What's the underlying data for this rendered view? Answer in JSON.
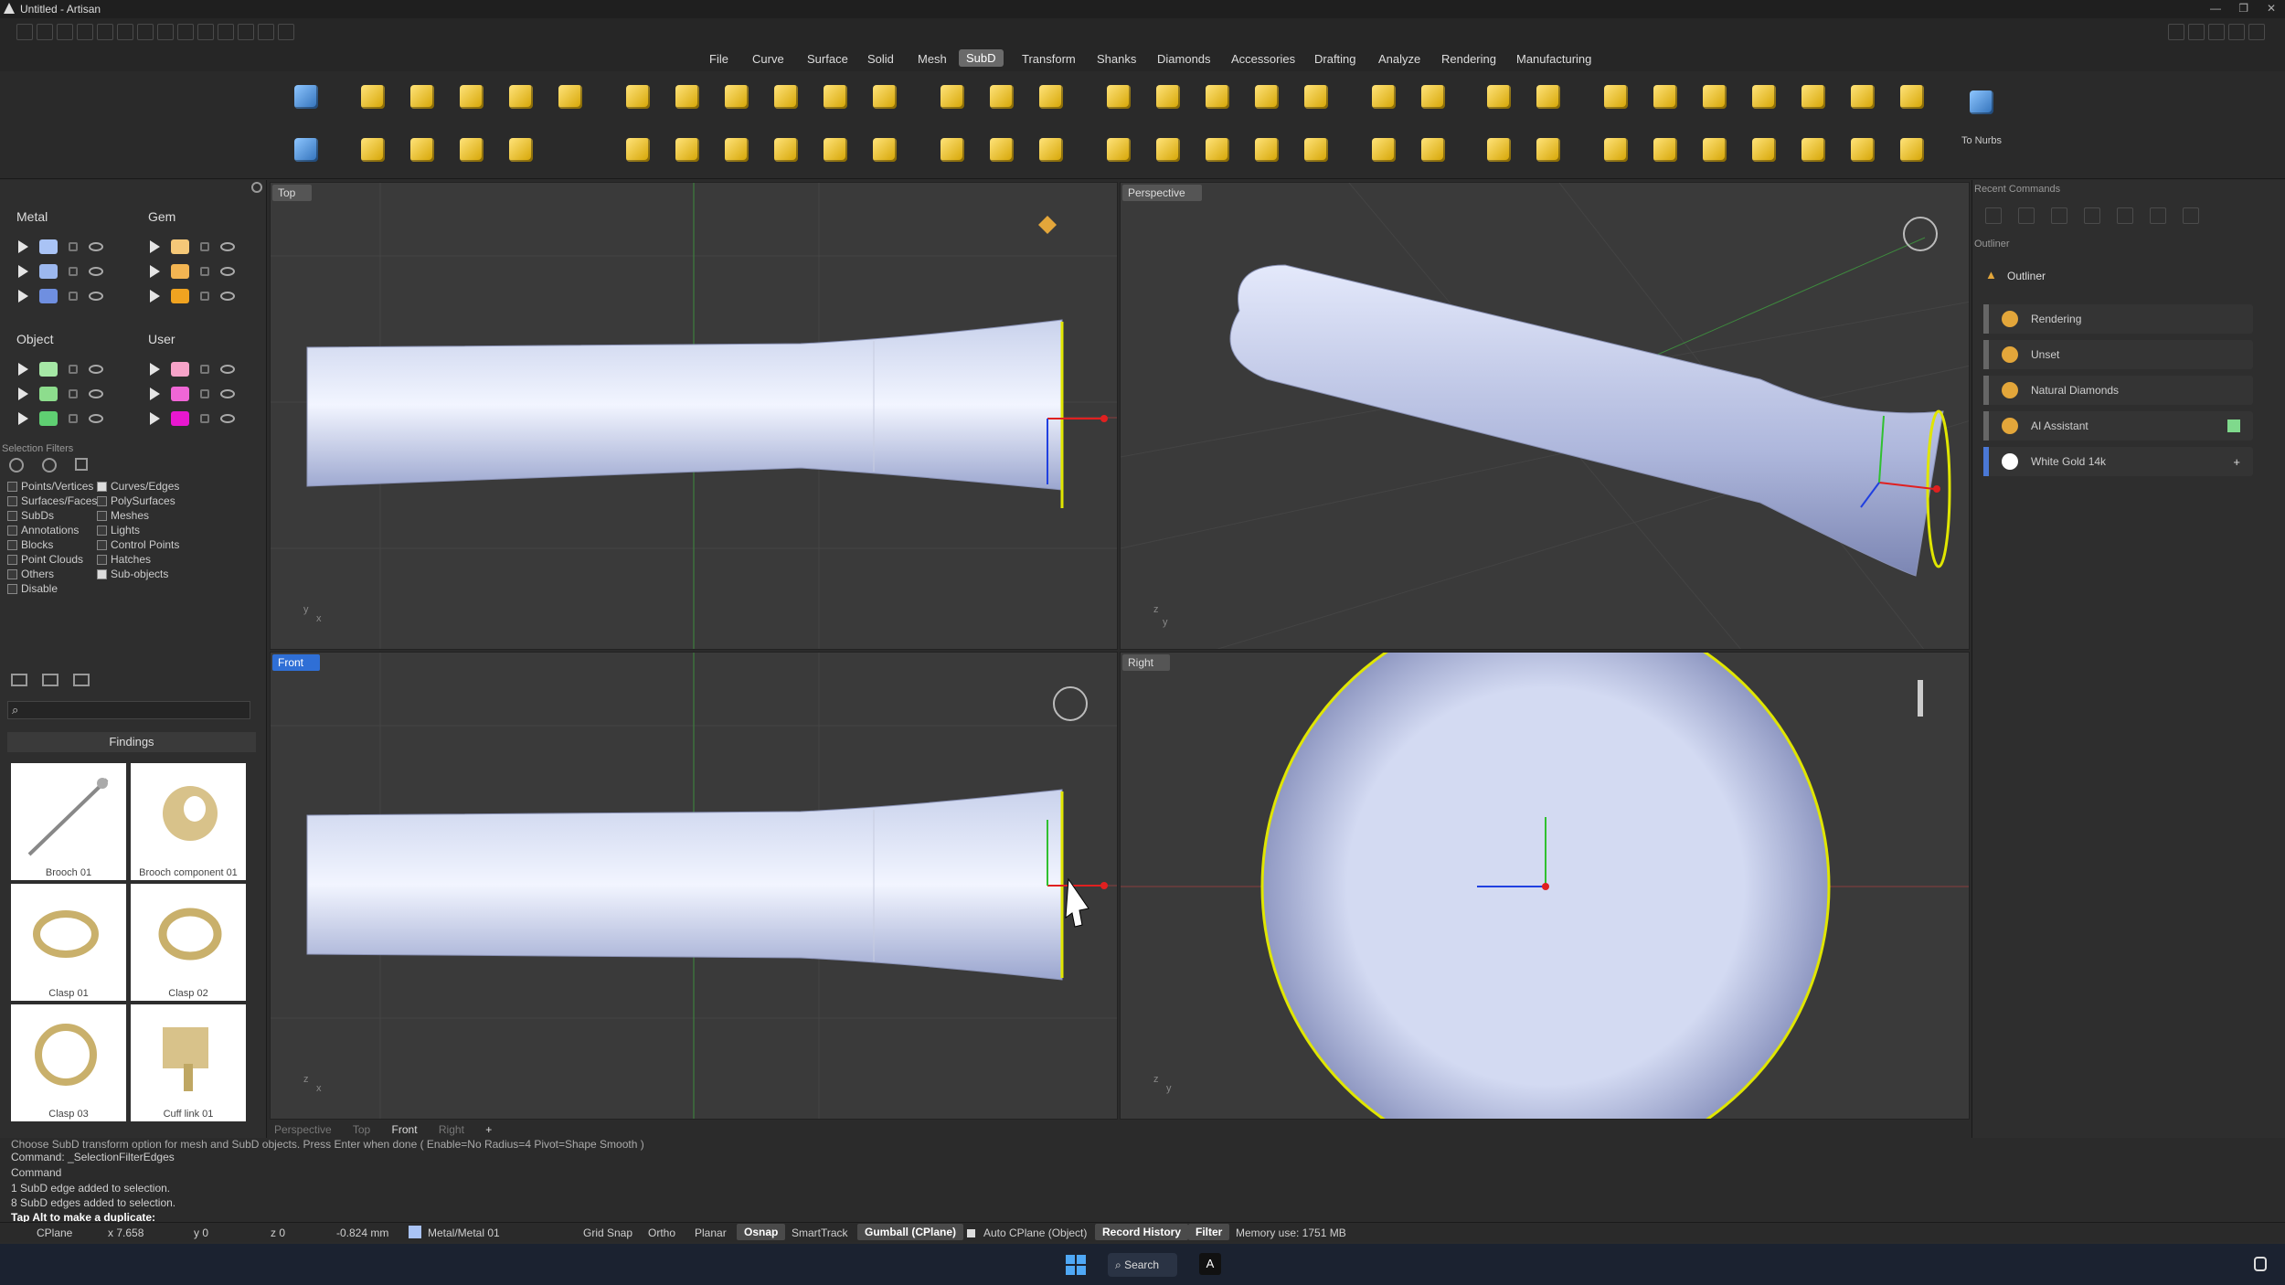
{
  "app": {
    "title": "Untitled - Artisan"
  },
  "menu": [
    "File",
    "Curve",
    "Surface",
    "Solid",
    "Mesh",
    "SubD",
    "Transform",
    "Shanks",
    "Diamonds",
    "Accessories",
    "Drafting",
    "Analyze",
    "Rendering",
    "Manufacturing"
  ],
  "menu_active": "SubD",
  "toolbar": {
    "to_nurbs": "To Nurbs"
  },
  "layers": {
    "metal": {
      "title": "Metal",
      "colors": [
        "#a9c3f5",
        "#9cb8ef",
        "#6f8fe0"
      ]
    },
    "gem": {
      "title": "Gem",
      "colors": [
        "#f5c878",
        "#f3b552",
        "#f0a320"
      ]
    },
    "object": {
      "title": "Object",
      "colors": [
        "#a6e8a6",
        "#8ddd8d",
        "#5fcf72"
      ]
    },
    "user": {
      "title": "User",
      "colors": [
        "#f7a3c9",
        "#f066d6",
        "#e817cf"
      ]
    }
  },
  "selection_filters": {
    "title": "Selection Filters",
    "left": [
      {
        "label": "Points/Vertices",
        "on": false
      },
      {
        "label": "Surfaces/Faces",
        "on": false
      },
      {
        "label": "SubDs",
        "on": false
      },
      {
        "label": "Annotations",
        "on": false
      },
      {
        "label": "Blocks",
        "on": false
      },
      {
        "label": "Point Clouds",
        "on": false
      },
      {
        "label": "Others",
        "on": false
      },
      {
        "label": "Disable",
        "on": false
      }
    ],
    "right": [
      {
        "label": "Curves/Edges",
        "on": true
      },
      {
        "label": "PolySurfaces",
        "on": false
      },
      {
        "label": "Meshes",
        "on": false
      },
      {
        "label": "Lights",
        "on": false
      },
      {
        "label": "Control Points",
        "on": false
      },
      {
        "label": "Hatches",
        "on": false
      },
      {
        "label": "Sub-objects",
        "on": true
      }
    ]
  },
  "library": {
    "category": "Findings",
    "items": [
      "Brooch 01",
      "Brooch component 01",
      "Clasp 01",
      "Clasp 02",
      "Clasp 03",
      "Cuff link 01"
    ]
  },
  "viewports": {
    "top": "Top",
    "perspective": "Perspective",
    "front": "Front",
    "right": "Right"
  },
  "view_tabs": [
    "Perspective",
    "Top",
    "Front",
    "Right"
  ],
  "right_panel": {
    "recent": "Recent Commands",
    "outliner_header": "Outliner",
    "outliner_title": "Outliner",
    "items": [
      "Rendering",
      "Unset",
      "Natural Diamonds",
      "AI Assistant",
      "White Gold 14k"
    ]
  },
  "command": {
    "lines": [
      "Choose SubD transform option for mesh and SubD objects. Press Enter when done ( Enable=No Radius=4 Pivot=Shape Smooth )",
      "Command: _SelectionFilterEdges",
      "Command",
      "1 SubD edge added to selection.",
      "8 SubD edges added to selection."
    ],
    "prompt": "Tap Alt to make a duplicate:"
  },
  "status": {
    "cplane": "CPlane",
    "x": "x 7.658",
    "y": "y 0",
    "z": "z 0",
    "dist": "-0.824 mm",
    "layer": "Metal/Metal 01",
    "grid_snap": "Grid Snap",
    "ortho": "Ortho",
    "planar": "Planar",
    "osnap": "Osnap",
    "smarttrack": "SmartTrack",
    "gumball": "Gumball (CPlane)",
    "auto_cplane": "Auto CPlane (Object)",
    "record_history": "Record History",
    "filter": "Filter",
    "memory": "Memory use: 1751 MB"
  },
  "taskbar": {
    "search": "Search"
  }
}
